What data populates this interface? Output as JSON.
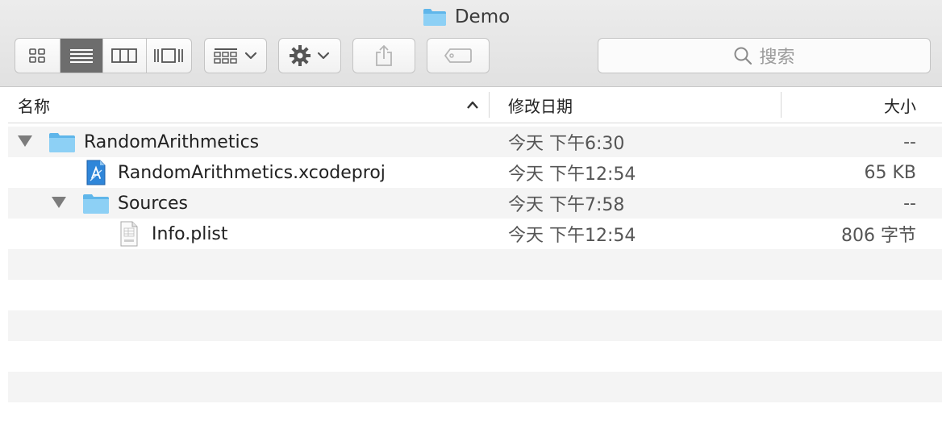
{
  "window": {
    "title": "Demo"
  },
  "toolbar": {
    "view_modes": [
      "icon-view",
      "list-view",
      "column-view",
      "cover-flow-view"
    ],
    "active_view": "list-view",
    "search_placeholder": "搜索"
  },
  "columns": {
    "name": "名称",
    "date": "修改日期",
    "size": "大小",
    "sort": "ascending"
  },
  "files": [
    {
      "name": "RandomArithmetics",
      "kind": "folder",
      "expanded": true,
      "date": "今天 下午6:30",
      "size": "--"
    },
    {
      "name": "RandomArithmetics.xcodeproj",
      "kind": "xcodeproj",
      "date": "今天 下午12:54",
      "size": "65 KB"
    },
    {
      "name": "Sources",
      "kind": "folder",
      "expanded": true,
      "date": "今天 下午7:58",
      "size": "--"
    },
    {
      "name": "Info.plist",
      "kind": "plist",
      "date": "今天 下午12:54",
      "size": "806 字节"
    }
  ],
  "colors": {
    "folder": "#79c8f3",
    "active_segment": "#6d6d6d",
    "stripe": "#f4f4f4"
  }
}
